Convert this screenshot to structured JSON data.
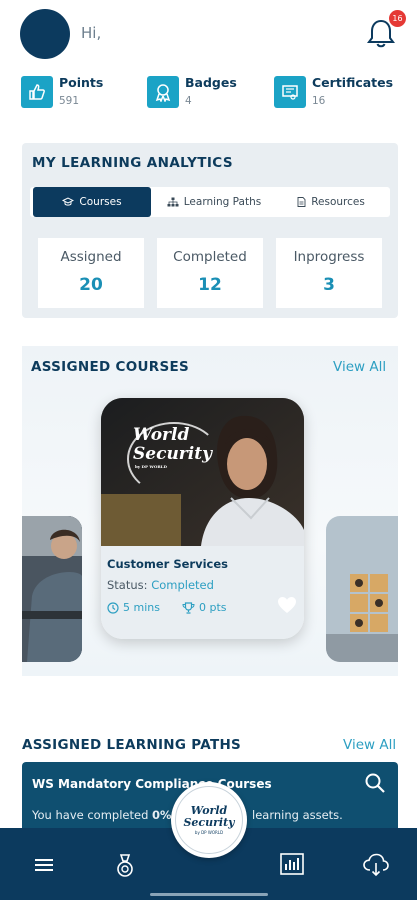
{
  "header": {
    "greeting": "Hi,",
    "notification_count": "16"
  },
  "stats": [
    {
      "label": "Points",
      "value": "591",
      "icon": "thumbs-up-icon"
    },
    {
      "label": "Badges",
      "value": "4",
      "icon": "badge-icon"
    },
    {
      "label": "Certificates",
      "value": "16",
      "icon": "certificate-icon"
    }
  ],
  "analytics": {
    "title": "MY LEARNING ANALYTICS",
    "tabs": [
      {
        "label": "Courses",
        "active": true,
        "icon": "graduation-cap-icon"
      },
      {
        "label": "Learning Paths",
        "active": false,
        "icon": "sitemap-icon"
      },
      {
        "label": "Resources",
        "active": false,
        "icon": "document-icon"
      }
    ],
    "metrics": [
      {
        "label": "Assigned",
        "value": "20"
      },
      {
        "label": "Completed",
        "value": "12"
      },
      {
        "label": "Inprogress",
        "value": "3"
      }
    ]
  },
  "assigned_courses": {
    "title": "ASSIGNED COURSES",
    "view_all": "View All",
    "featured": {
      "brand_line1": "World",
      "brand_line2": "Security",
      "brand_line3": "by DP WORLD",
      "name": "Customer Services",
      "status_label": "Status:",
      "status_value": "Completed",
      "duration": "5 mins",
      "points": "0 pts"
    }
  },
  "assigned_paths": {
    "title": "ASSIGNED LEARNING PATHS",
    "view_all": "View All",
    "card_title": "WS Mandatory Compliance Courses",
    "completed_prefix": "You have completed ",
    "completed_value": "0%",
    "completed_suffix": "learning assets."
  },
  "home_button": {
    "line1": "World",
    "line2": "Security",
    "line3": "by DP WORLD"
  },
  "colors": {
    "navy": "#0c3a5e",
    "accent": "#1ba3c6",
    "link": "#2d9fc2",
    "badge_red": "#e53935"
  }
}
